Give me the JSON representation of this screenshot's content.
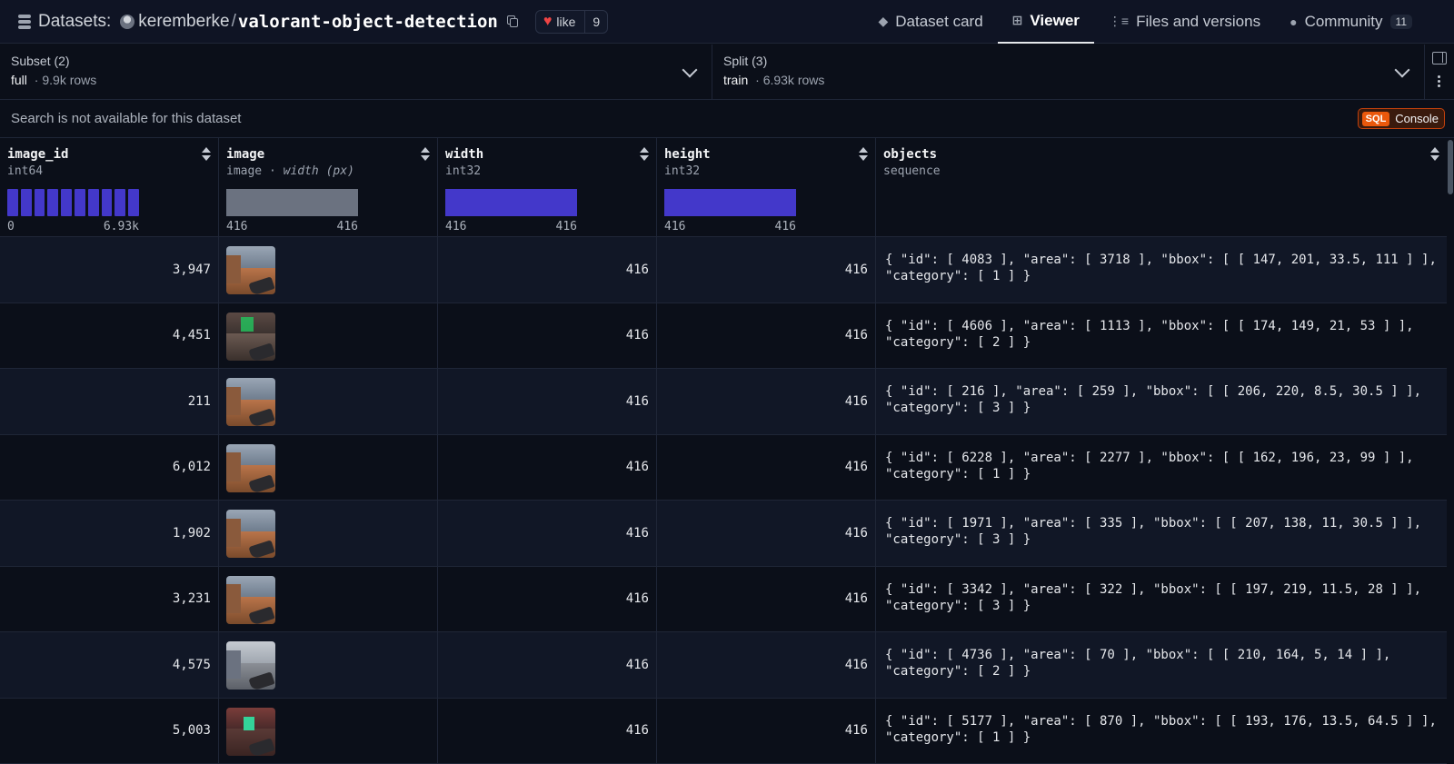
{
  "header": {
    "section": "Datasets:",
    "owner": "keremberke",
    "repo": "valorant-object-detection",
    "like_label": "like",
    "like_count": "9",
    "tabs": [
      {
        "label": "Dataset card",
        "icon": "cube-icon"
      },
      {
        "label": "Viewer",
        "icon": "table-icon",
        "active": true
      },
      {
        "label": "Files and versions",
        "icon": "files-icon"
      },
      {
        "label": "Community",
        "icon": "hugging-face-icon",
        "badge": "11"
      }
    ]
  },
  "subset": {
    "title": "Subset (2)",
    "value": "full",
    "rows": "9.9k rows"
  },
  "split": {
    "title": "Split (3)",
    "value": "train",
    "rows": "6.93k rows"
  },
  "search": {
    "message": "Search is not available for this dataset"
  },
  "sql_button": {
    "tag": "SQL",
    "label": "Console"
  },
  "columns": [
    {
      "name": "image_id",
      "type": "int64",
      "min": "0",
      "max": "6.93k"
    },
    {
      "name": "image",
      "type": "image",
      "type_extra": "width (px)",
      "min": "416",
      "max": "416"
    },
    {
      "name": "width",
      "type": "int32",
      "min": "416",
      "max": "416"
    },
    {
      "name": "height",
      "type": "int32",
      "min": "416",
      "max": "416"
    },
    {
      "name": "objects",
      "type": "sequence"
    }
  ],
  "colors": {
    "histogram": "#4338ca",
    "image_histogram": "#6b7280",
    "sql_accent": "#ea580c"
  },
  "rows": [
    {
      "image_id": "3,947",
      "width": "416",
      "height": "416",
      "objects": "{ \"id\": [ 4083 ], \"area\": [ 3718 ], \"bbox\": [ [ 147, 201, 33.5, 111 ] ],\n\"category\": [ 1 ] }"
    },
    {
      "image_id": "4,451",
      "width": "416",
      "height": "416",
      "objects": "{ \"id\": [ 4606 ], \"area\": [ 1113 ], \"bbox\": [ [ 174, 149, 21, 53 ] ],\n\"category\": [ 2 ] }"
    },
    {
      "image_id": "211",
      "width": "416",
      "height": "416",
      "objects": "{ \"id\": [ 216 ], \"area\": [ 259 ], \"bbox\": [ [ 206, 220, 8.5, 30.5 ] ],\n\"category\": [ 3 ] }"
    },
    {
      "image_id": "6,012",
      "width": "416",
      "height": "416",
      "objects": "{ \"id\": [ 6228 ], \"area\": [ 2277 ], \"bbox\": [ [ 162, 196, 23, 99 ] ],\n\"category\": [ 1 ] }"
    },
    {
      "image_id": "1,902",
      "width": "416",
      "height": "416",
      "objects": "{ \"id\": [ 1971 ], \"area\": [ 335 ], \"bbox\": [ [ 207, 138, 11, 30.5 ] ],\n\"category\": [ 3 ] }"
    },
    {
      "image_id": "3,231",
      "width": "416",
      "height": "416",
      "objects": "{ \"id\": [ 3342 ], \"area\": [ 322 ], \"bbox\": [ [ 197, 219, 11.5, 28 ] ],\n\"category\": [ 3 ] }"
    },
    {
      "image_id": "4,575",
      "width": "416",
      "height": "416",
      "objects": "{ \"id\": [ 4736 ], \"area\": [ 70 ], \"bbox\": [ [ 210, 164, 5, 14 ] ],\n\"category\": [ 2 ] }"
    },
    {
      "image_id": "5,003",
      "width": "416",
      "height": "416",
      "objects": "{ \"id\": [ 5177 ], \"area\": [ 870 ], \"bbox\": [ [ 193, 176, 13.5, 64.5 ] ],\n\"category\": [ 1 ] }"
    }
  ]
}
